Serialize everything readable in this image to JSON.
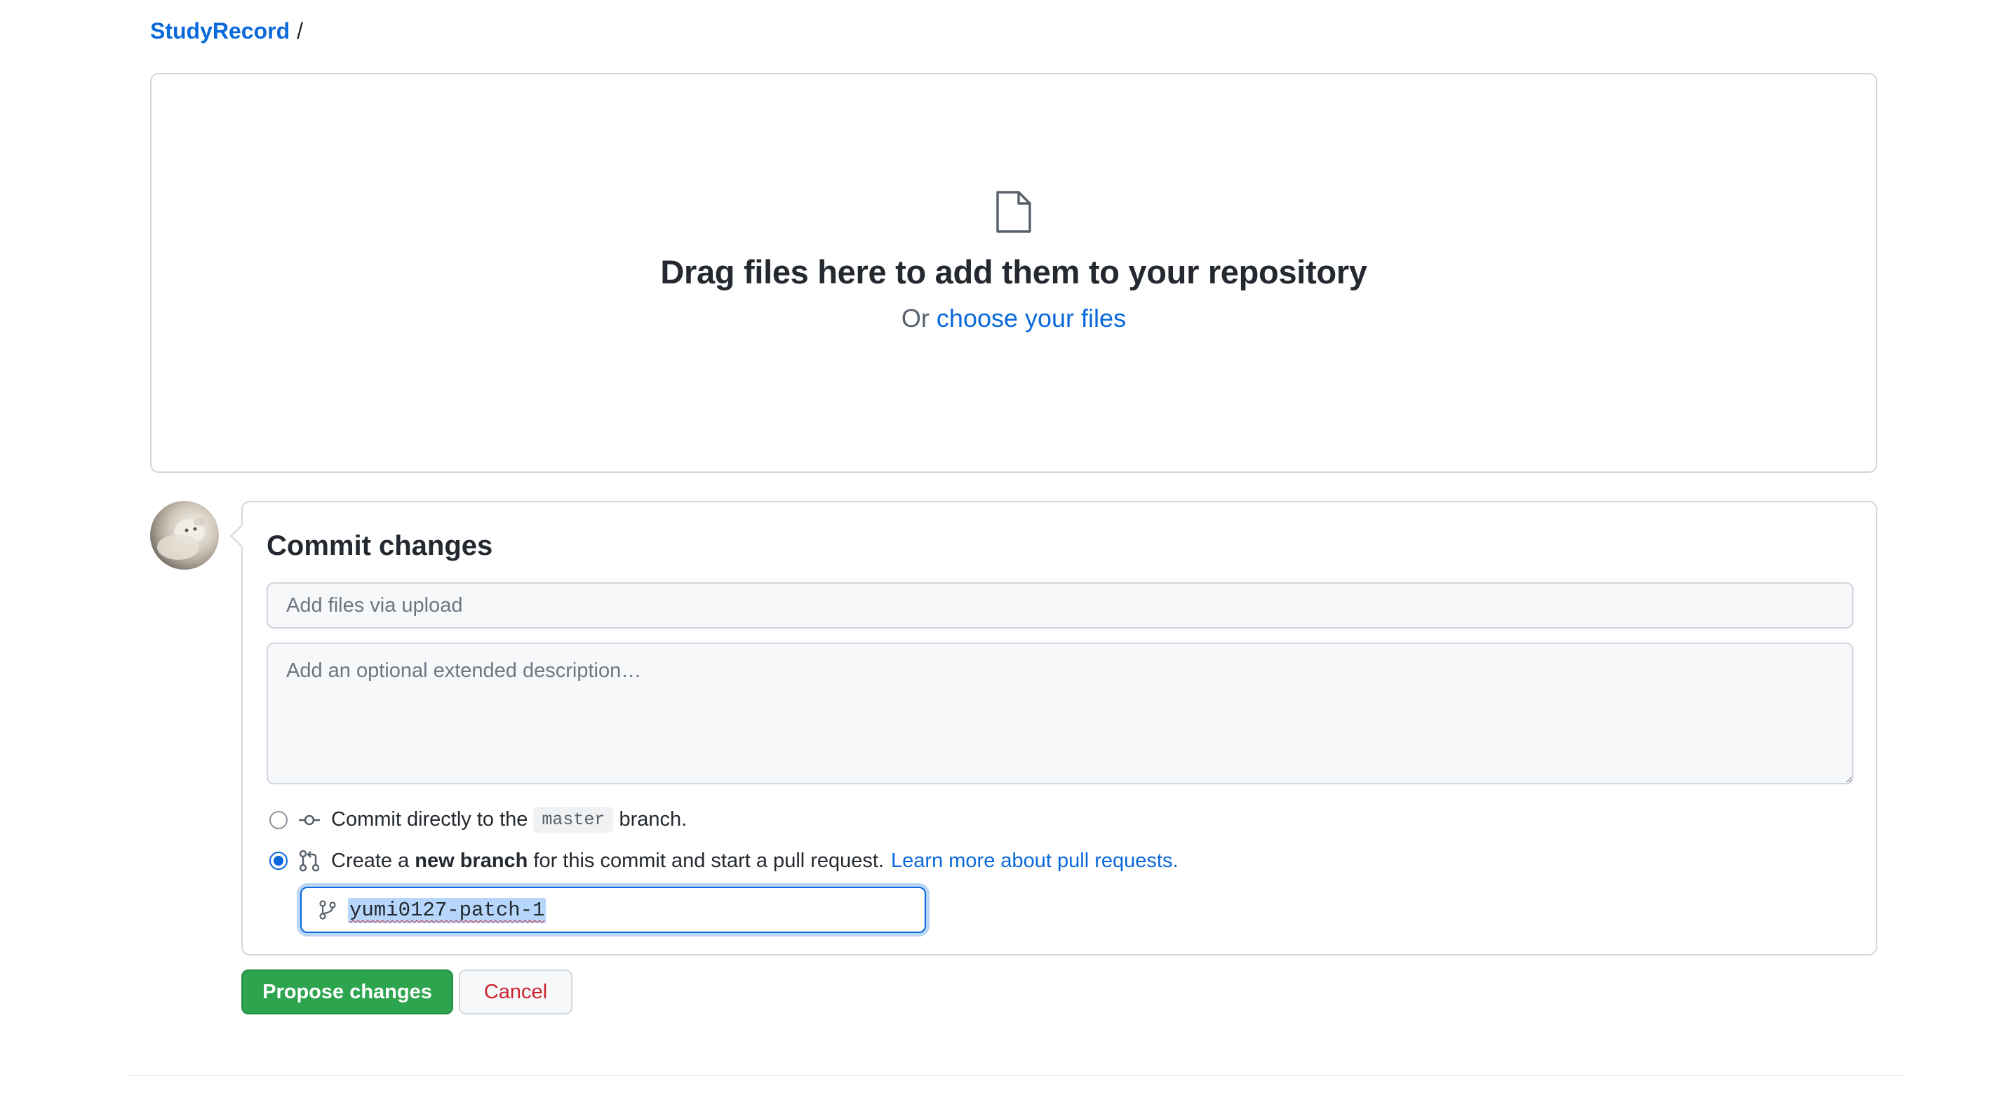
{
  "breadcrumb": {
    "repo": "StudyRecord",
    "separator": "/"
  },
  "dropzone": {
    "icon": "file-icon",
    "headline": "Drag files here to add them to your repository",
    "or_text": "Or",
    "choose_link": "choose your files"
  },
  "avatar": {
    "icon": "user-avatar"
  },
  "commit": {
    "title": "Commit changes",
    "summary_placeholder": "Add files via upload",
    "description_placeholder": "Add an optional extended description…",
    "option_direct": {
      "selected": false,
      "icon": "git-commit-icon",
      "text_before": "Commit directly to the",
      "branch": "master",
      "text_after": "branch."
    },
    "option_new_branch": {
      "selected": true,
      "icon": "git-pull-request-icon",
      "text_before": "Create a",
      "bold": "new branch",
      "text_after": "for this commit and start a pull request.",
      "link": "Learn more about pull requests."
    },
    "branch_field": {
      "icon": "git-branch-icon",
      "value": "yumi0127-patch-1"
    }
  },
  "actions": {
    "propose": "Propose changes",
    "cancel": "Cancel"
  },
  "colors": {
    "link": "#0969da",
    "primary_button": "#2da44e",
    "danger_text": "#cf222e",
    "border": "#d0d7de"
  }
}
